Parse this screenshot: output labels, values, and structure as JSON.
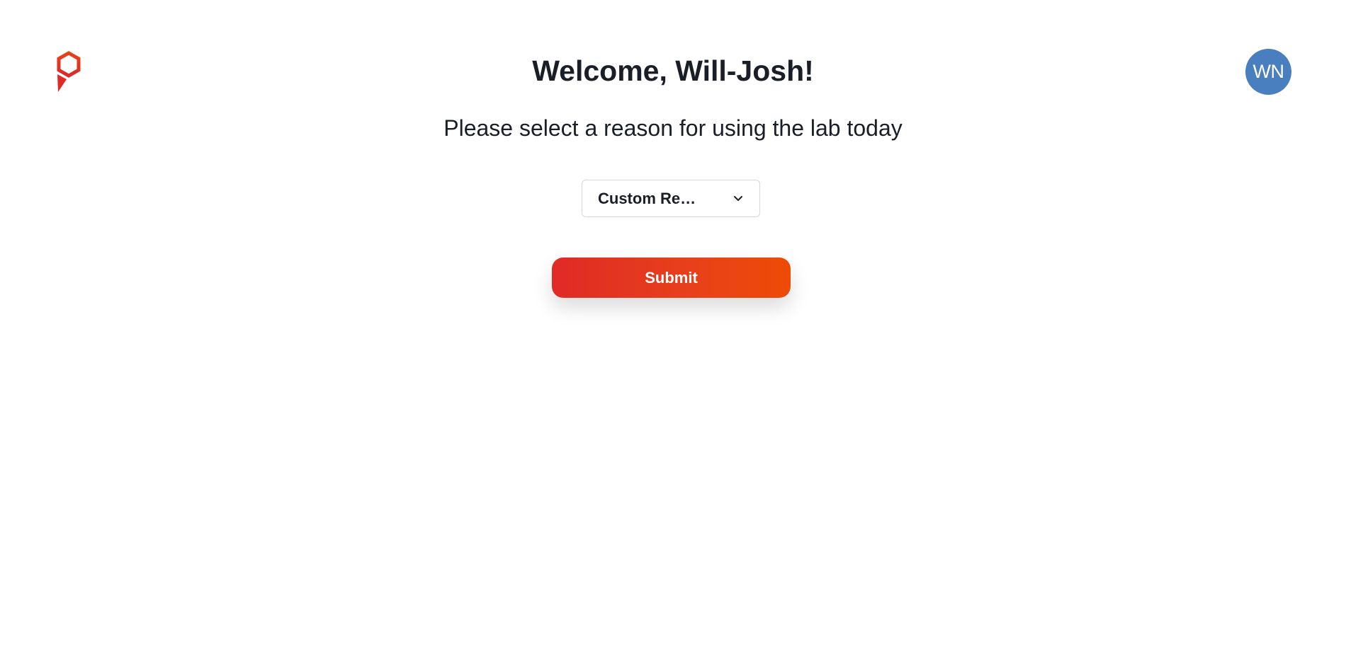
{
  "header": {
    "logo_icon": "hexagon-pin-logo-icon",
    "welcome_title": "Welcome, Will-Josh!",
    "avatar_initials": "WN",
    "avatar_color": "#4a7fbf"
  },
  "form": {
    "prompt": "Please select a reason for using the lab today",
    "reason_select": {
      "selected_value": "Custom Re…",
      "icon": "chevron-down-icon"
    },
    "submit_label": "Submit",
    "accent_gradient": [
      "#e02a26",
      "#ee4b06"
    ]
  }
}
